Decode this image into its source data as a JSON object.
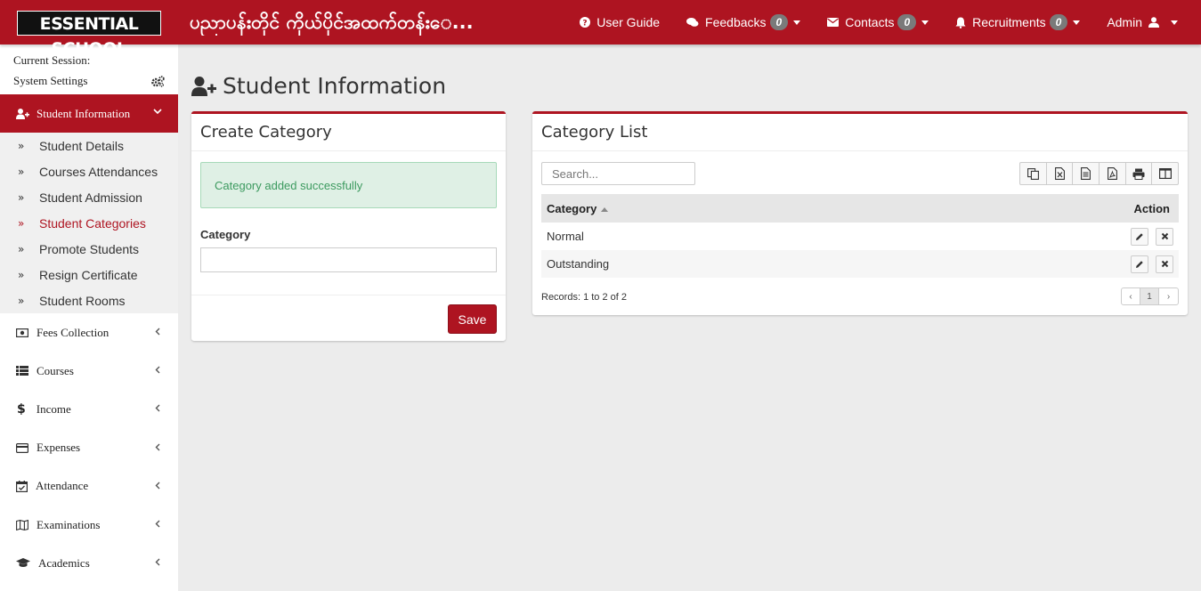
{
  "header": {
    "logo": "ESSENTIAL SCHOOL",
    "app_title": "ပညာပန်းတိုင် ကိုယ်ပိုင်အထက်တန်းေ...",
    "nav": {
      "user_guide": "User Guide",
      "feedbacks": "Feedbacks",
      "feedbacks_count": "0",
      "contacts": "Contacts",
      "contacts_count": "0",
      "recruitments": "Recruitments",
      "recruitments_count": "0",
      "admin": "Admin"
    }
  },
  "sidebar": {
    "current_session": "Current Session:",
    "system_settings": "System Settings",
    "active_menu": "Student Information",
    "submenu": [
      {
        "label": "Student Details"
      },
      {
        "label": "Courses Attendances"
      },
      {
        "label": "Student Admission"
      },
      {
        "label": "Student Categories"
      },
      {
        "label": "Promote Students"
      },
      {
        "label": "Resign Certificate"
      },
      {
        "label": "Student Rooms"
      }
    ],
    "menu": [
      {
        "label": "Fees Collection",
        "icon": "money-icon"
      },
      {
        "label": "Courses",
        "icon": "list-icon"
      },
      {
        "label": "Income",
        "icon": "dollar-icon"
      },
      {
        "label": "Expenses",
        "icon": "credit-card-icon"
      },
      {
        "label": "Attendance",
        "icon": "calendar-check-icon"
      },
      {
        "label": "Examinations",
        "icon": "map-icon"
      },
      {
        "label": "Academics",
        "icon": "graduation-cap-icon"
      }
    ]
  },
  "main": {
    "page_title": "Student Information",
    "create": {
      "title": "Create Category",
      "alert": "Category added successfully",
      "field_label": "Category",
      "field_value": "",
      "save_label": "Save"
    },
    "list": {
      "title": "Category List",
      "search_placeholder": "Search...",
      "columns": {
        "category": "Category",
        "action": "Action"
      },
      "rows": [
        {
          "category": "Normal"
        },
        {
          "category": "Outstanding"
        }
      ],
      "records": "Records: 1 to 2 of 2",
      "pager": {
        "prev": "‹",
        "current": "1",
        "next": "›"
      }
    }
  },
  "colors": {
    "brand": "#ae1421",
    "success_bg": "#dff0e5",
    "success_text": "#3c9a5f"
  }
}
